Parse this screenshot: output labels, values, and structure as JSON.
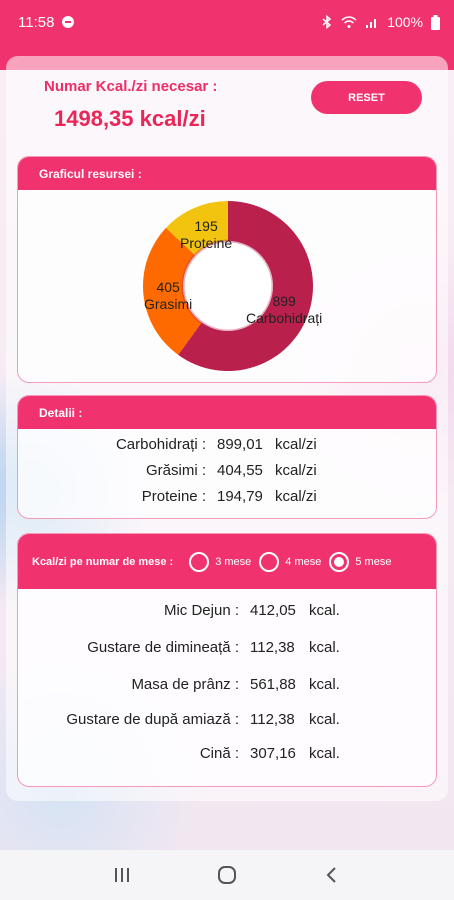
{
  "status_bar": {
    "time": "11:58",
    "battery": "100%"
  },
  "header": {
    "kcal_title": "Numar Kcal./zi necesar :",
    "kcal_value": "1498,35  kcal/zi",
    "reset_label": "RESET"
  },
  "chart_card": {
    "title": "Graficul resursei :"
  },
  "chart_data": {
    "type": "pie",
    "title": "",
    "donut": true,
    "categories": [
      "Carbohidrați",
      "Grasimi",
      "Proteine"
    ],
    "values": [
      899,
      405,
      195
    ],
    "labels": [
      "899",
      "405",
      "195"
    ],
    "colors": [
      "#b9204c",
      "#ff6a00",
      "#f2c40f"
    ]
  },
  "details_card": {
    "title": "Detalii :",
    "rows": [
      {
        "label": "Carbohidrați :",
        "value": "899,01",
        "unit": "kcal/zi"
      },
      {
        "label": "Grăsimi :",
        "value": "404,55",
        "unit": "kcal/zi"
      },
      {
        "label": "Proteine :",
        "value": "194,79",
        "unit": "kcal/zi"
      }
    ]
  },
  "meals_card": {
    "title": "Kcal/zi pe numar de mese :",
    "options": [
      "3 mese",
      "4 mese",
      "5 mese"
    ],
    "selected": "5 mese",
    "rows": [
      {
        "label": "Mic Dejun :",
        "value": "412,05",
        "unit": "kcal."
      },
      {
        "label": "Gustare de dimineață :",
        "value": "112,38",
        "unit": "kcal."
      },
      {
        "label": "Masa de prânz :",
        "value": "561,88",
        "unit": "kcal."
      },
      {
        "label": "Gustare de după amiază :",
        "value": "112,38",
        "unit": "kcal."
      },
      {
        "label": "Cină :",
        "value": "307,16",
        "unit": "kcal."
      }
    ]
  },
  "colors": {
    "accent": "#f0336e",
    "value_text": "#ea2659"
  },
  "icons": {
    "status_left": [
      "notification-dot-icon"
    ],
    "status_right": [
      "bluetooth-icon",
      "wifi-icon",
      "signal-icon",
      "battery-icon"
    ],
    "nav": [
      "recents-icon",
      "home-icon",
      "back-icon"
    ]
  }
}
